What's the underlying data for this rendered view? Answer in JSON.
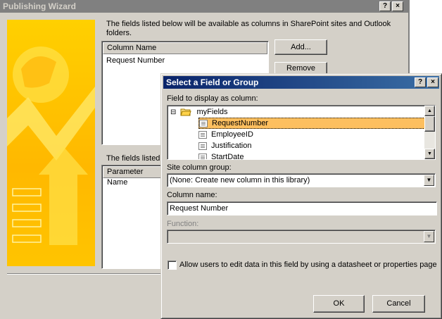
{
  "wizard": {
    "title": "Publishing Wizard",
    "help_btn": "?",
    "close_btn": "×",
    "intro_text": "The fields listed below will be available as columns in SharePoint sites and Outlook folders.",
    "columns_header": "Column Name",
    "columns": [
      "Request Number"
    ],
    "add_button": "Add...",
    "remove_button": "Remove",
    "params_text": "The fields listed",
    "params_header": "Parameter Name"
  },
  "dialog": {
    "title": "Select a Field or Group",
    "help_btn": "?",
    "close_btn": "×",
    "field_label": "Field to display as column:",
    "tree": {
      "root": "myFields",
      "expander": "⊟",
      "items": [
        "RequestNumber",
        "EmployeeID",
        "Justification",
        "StartDate"
      ],
      "selected_index": 0
    },
    "site_group_label": "Site column group:",
    "site_group_value": "(None: Create new column in this library)",
    "column_name_label": "Column name:",
    "column_name_value": "Request Number",
    "function_label": "Function:",
    "function_value": "",
    "checkbox_label": "Allow users to edit data in this field by using a datasheet or properties page",
    "checkbox_checked": false,
    "ok_button": "OK",
    "cancel_button": "Cancel"
  },
  "colors": {
    "title_active_start": "#0a246a",
    "title_active_end": "#3a6ea5",
    "title_inactive": "#808080",
    "selection": "#fdbf5f",
    "art_yellow": "#ffc400"
  }
}
